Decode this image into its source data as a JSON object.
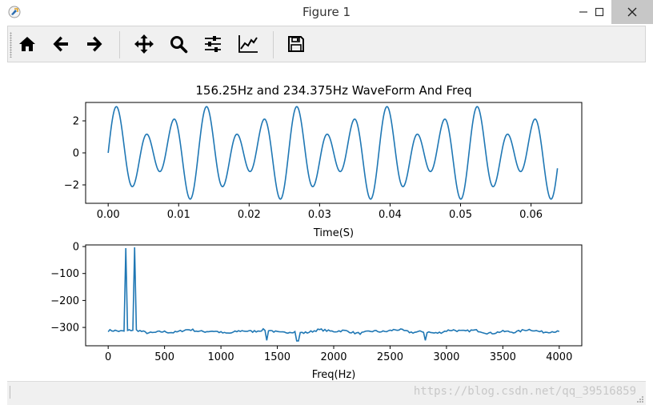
{
  "window": {
    "title": "Figure 1"
  },
  "toolbar": {
    "buttons": [
      {
        "name": "home",
        "icon": "home-icon"
      },
      {
        "name": "back",
        "icon": "arrow-left-icon"
      },
      {
        "name": "forward",
        "icon": "arrow-right-icon"
      },
      {
        "name": "pan",
        "icon": "move-icon"
      },
      {
        "name": "zoom",
        "icon": "magnifier-icon"
      },
      {
        "name": "configure-subplots",
        "icon": "sliders-icon"
      },
      {
        "name": "edit-axis",
        "icon": "line-chart-icon"
      },
      {
        "name": "save",
        "icon": "floppy-disk-icon"
      }
    ]
  },
  "status": {
    "watermark": "https://blog.csdn.net/qq_39516859"
  },
  "colors": {
    "line": "#1f77b4"
  },
  "chart_data": [
    {
      "type": "line",
      "title": "156.25Hz and 234.375Hz WaveForm And Freq",
      "xlabel": "Time(S)",
      "ylabel": "",
      "xlim": [
        -0.0032,
        0.0672
      ],
      "ylim": [
        -3.15,
        3.15
      ],
      "xticks": [
        0.0,
        0.01,
        0.02,
        0.03,
        0.04,
        0.05,
        0.06
      ],
      "xticklabels": [
        "0.00",
        "0.01",
        "0.02",
        "0.03",
        "0.04",
        "0.05",
        "0.06"
      ],
      "yticks": [
        -2,
        0,
        2
      ],
      "yticklabels": [
        "−2",
        "0",
        "2"
      ],
      "series": [
        {
          "formula": "sin(2π·156.25·t) + 2·sin(2π·234.375·t)",
          "x_start": 0,
          "x_end": 0.06375,
          "samples": 256
        }
      ]
    },
    {
      "type": "line",
      "title": "",
      "xlabel": "Freq(Hz)",
      "ylabel": "",
      "xlim": [
        -200,
        4200
      ],
      "ylim": [
        -368,
        6
      ],
      "xticks": [
        0,
        500,
        1000,
        1500,
        2000,
        2500,
        3000,
        3500,
        4000
      ],
      "xticklabels": [
        "0",
        "500",
        "1000",
        "1500",
        "2000",
        "2500",
        "3000",
        "3500",
        "4000"
      ],
      "yticks": [
        0,
        -100,
        -200,
        -300
      ],
      "yticklabels": [
        "0",
        "−100",
        "−200",
        "−300"
      ],
      "series": [
        {
          "x_start": 0,
          "x_step": 15.625,
          "baseline": -315,
          "peaks": [
            {
              "x": 156.25,
              "y": -6
            },
            {
              "x": 234.375,
              "y": -3
            }
          ],
          "dips": [
            {
              "x": 1400,
              "y": -348
            },
            {
              "x": 1680,
              "y": -350
            },
            {
              "x": 2810,
              "y": -348
            }
          ],
          "points_shown": 257
        }
      ]
    }
  ]
}
